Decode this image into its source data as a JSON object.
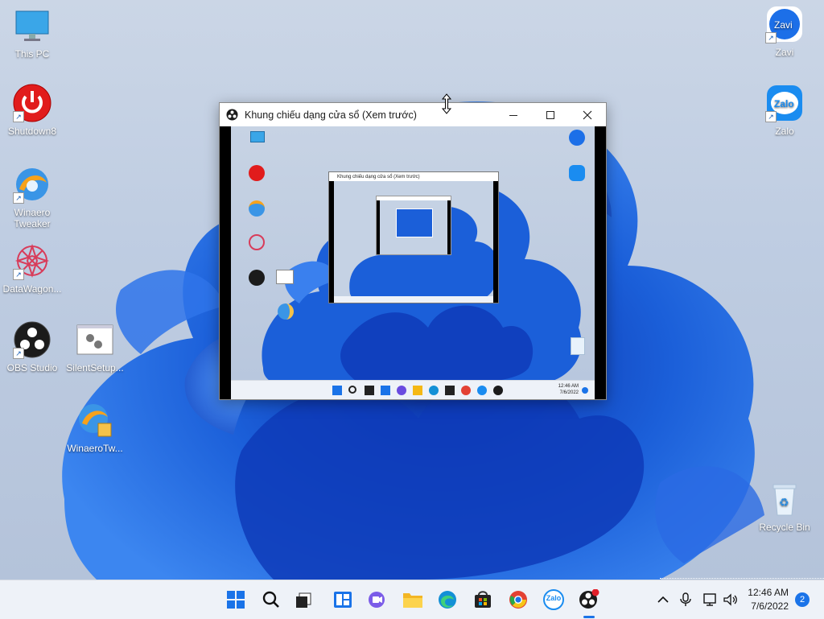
{
  "desktop": {
    "icons": [
      {
        "label": "This PC"
      },
      {
        "label": "Shutdown8"
      },
      {
        "label": "Winaero Tweaker"
      },
      {
        "label": "DataWagon..."
      },
      {
        "label": "OBS Studio"
      },
      {
        "label": "SilentSetup..."
      },
      {
        "label": "WinaeroTw..."
      },
      {
        "label": "Zavi"
      },
      {
        "label": "Zalo"
      },
      {
        "label": "Recycle Bin"
      }
    ]
  },
  "window": {
    "title": "Khung chiếu dạng cửa sổ (Xem trước)",
    "inner_title": "Khung chiếu dạng cửa sổ (Xem trước)",
    "inner_time": "12:46 AM",
    "inner_date": "7/6/2022"
  },
  "taskbar": {
    "time": "12:46 AM",
    "date": "7/6/2022",
    "notification_count": "2",
    "zalo_label": "Zalo"
  },
  "colors": {
    "accent": "#1a73e8",
    "bloom_blue": "#1b5fd9",
    "taskbar_bg": "#eef2f8"
  }
}
